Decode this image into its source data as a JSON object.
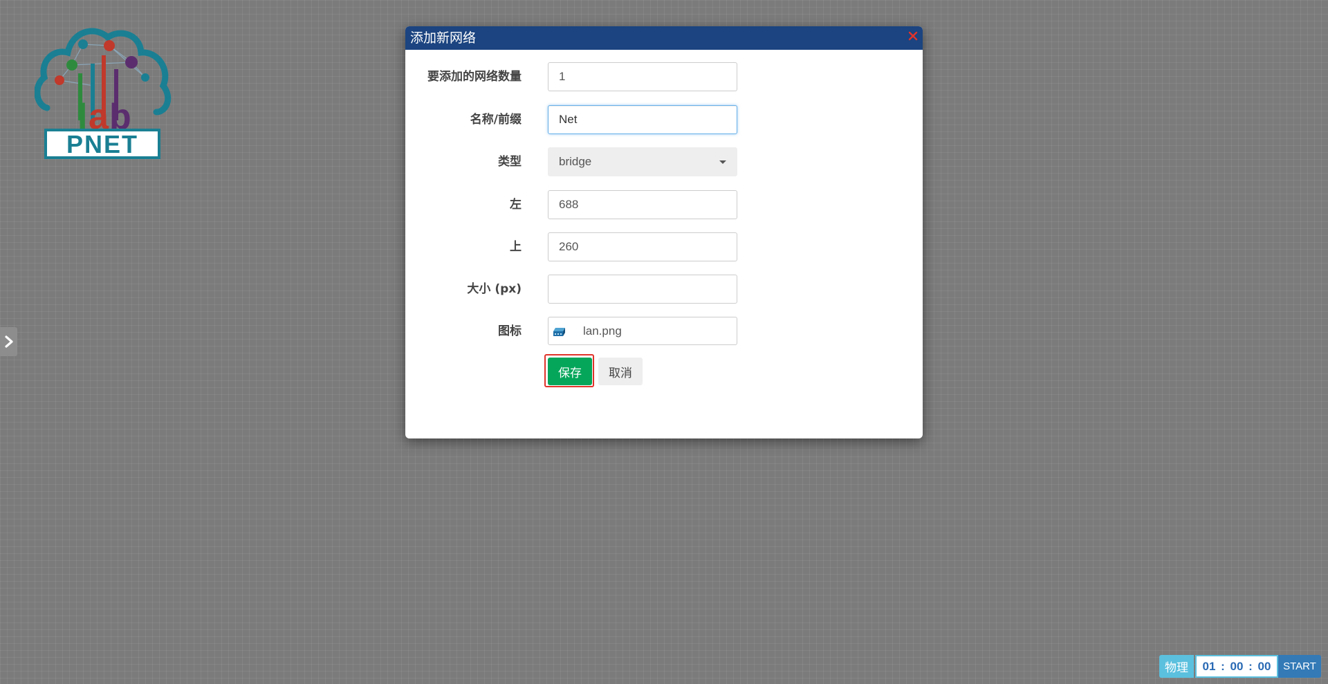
{
  "logo": {
    "text": "PNET",
    "lab_text": "lab"
  },
  "modal": {
    "title": "添加新网络",
    "fields": {
      "count": {
        "label": "要添加的网络数量",
        "value": "1"
      },
      "name": {
        "label": "名称/前缀",
        "value": "Net"
      },
      "type": {
        "label": "类型",
        "value": "bridge"
      },
      "left": {
        "label": "左",
        "value": "688"
      },
      "top": {
        "label": "上",
        "value": "260"
      },
      "size": {
        "label": "大小 (px)",
        "value": ""
      },
      "icon": {
        "label": "图标",
        "value": "lan.png",
        "icon": "lan-icon"
      }
    },
    "buttons": {
      "save": "保存",
      "cancel": "取消"
    }
  },
  "bottom_bar": {
    "mode": "物理",
    "timer": {
      "hours": "01",
      "minutes": "00",
      "seconds": "00",
      "separator": ":"
    },
    "start": "START"
  },
  "colors": {
    "header": "#1b4480",
    "save": "#05a65a",
    "highlight": "#e0332a",
    "mode": "#5bc0de",
    "start": "#337ab7"
  }
}
